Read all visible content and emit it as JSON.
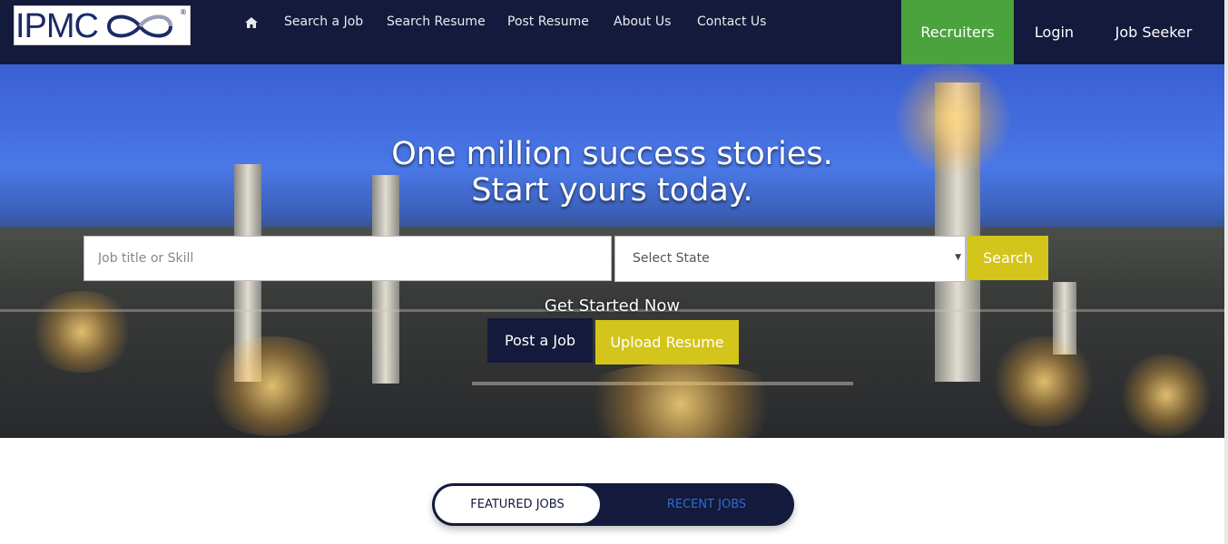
{
  "brand": {
    "logo_text": "IPMC",
    "logo_mark": "®"
  },
  "nav": {
    "home_icon": "home-icon",
    "items": [
      {
        "label": "Search a Job"
      },
      {
        "label": "Search Resume"
      },
      {
        "label": "Post Resume"
      },
      {
        "label": "About Us"
      },
      {
        "label": "Contact Us"
      }
    ],
    "recruiters": "Recruiters",
    "login": "Login",
    "job_seeker": "Job Seeker"
  },
  "hero": {
    "title_line1": "One million success stories.",
    "title_line2": "Start yours today.",
    "search_placeholder": "Job title or Skill",
    "state_select": "Select State",
    "search_button": "Search",
    "get_started": "Get Started Now",
    "post_job": "Post a Job",
    "upload_resume": "Upload Resume"
  },
  "tabs": {
    "featured": "FEATURED JOBS",
    "recent": "RECENT JOBS"
  },
  "colors": {
    "navy": "#131a3b",
    "green": "#4ba33d",
    "yellow": "#d4c51c",
    "link_blue": "#2f6bd0"
  }
}
